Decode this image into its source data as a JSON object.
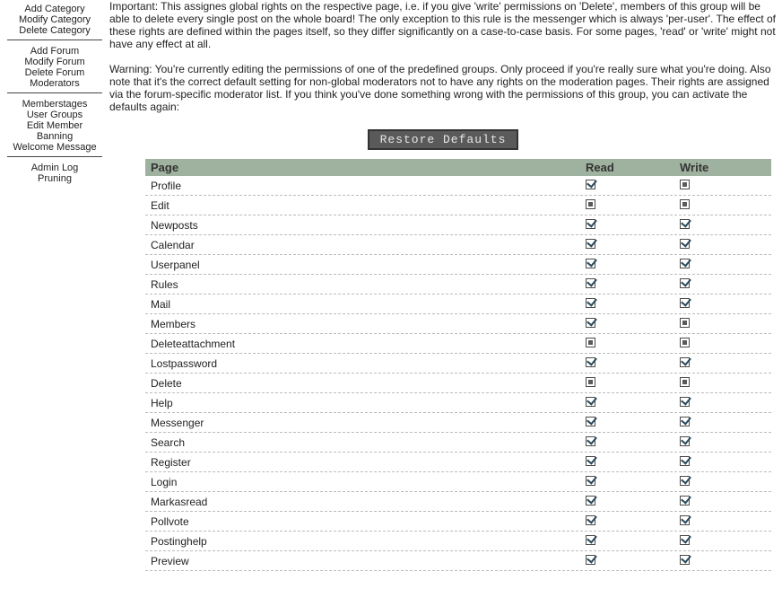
{
  "sidebar": {
    "groups": [
      [
        "Add Category",
        "Modify Category",
        "Delete Category"
      ],
      [
        "Add Forum",
        "Modify Forum",
        "Delete Forum",
        "Moderators"
      ],
      [
        "Memberstages",
        "User Groups",
        "Edit Member",
        "Banning",
        "Welcome Message"
      ],
      [
        "Admin Log",
        "Pruning"
      ]
    ]
  },
  "main": {
    "p1": "Important: This assignes global rights on the respective page, i.e. if you give 'write' permissions on 'Delete', members of this group will be able to delete every single post on the whole board! The only exception to this rule is the messenger which is always 'per-user'. The effect of these rights are defined within the pages itself, so they differ significantly on a case-to-case basis. For some pages, 'read' or 'write' might not have any effect at all.",
    "p2": "Warning: You're currently editing the permissions of one of the predefined groups. Only proceed if you're really sure what you're doing. Also note that it's the correct default setting for non-global moderators not to have any rights on the moderation pages. Their rights are assigned via the forum-specific moderator list. If you think you've done something wrong with the permissions of this group, you can activate the defaults again:",
    "restore": "Restore Defaults"
  },
  "table": {
    "h1": "Page",
    "h2": "Read",
    "h3": "Write",
    "rows": [
      {
        "page": "Profile",
        "read": true,
        "write": false
      },
      {
        "page": "Edit",
        "read": false,
        "write": false
      },
      {
        "page": "Newposts",
        "read": true,
        "write": true
      },
      {
        "page": "Calendar",
        "read": true,
        "write": true
      },
      {
        "page": "Userpanel",
        "read": true,
        "write": true
      },
      {
        "page": "Rules",
        "read": true,
        "write": true
      },
      {
        "page": "Mail",
        "read": true,
        "write": true
      },
      {
        "page": "Members",
        "read": true,
        "write": false
      },
      {
        "page": "Deleteattachment",
        "read": false,
        "write": false
      },
      {
        "page": "Lostpassword",
        "read": true,
        "write": true
      },
      {
        "page": "Delete",
        "read": false,
        "write": false
      },
      {
        "page": "Help",
        "read": true,
        "write": true
      },
      {
        "page": "Messenger",
        "read": true,
        "write": true
      },
      {
        "page": "Search",
        "read": true,
        "write": true
      },
      {
        "page": "Register",
        "read": true,
        "write": true
      },
      {
        "page": "Login",
        "read": true,
        "write": true
      },
      {
        "page": "Markasread",
        "read": true,
        "write": true
      },
      {
        "page": "Pollvote",
        "read": true,
        "write": true
      },
      {
        "page": "Postinghelp",
        "read": true,
        "write": true
      },
      {
        "page": "Preview",
        "read": true,
        "write": true
      }
    ]
  }
}
